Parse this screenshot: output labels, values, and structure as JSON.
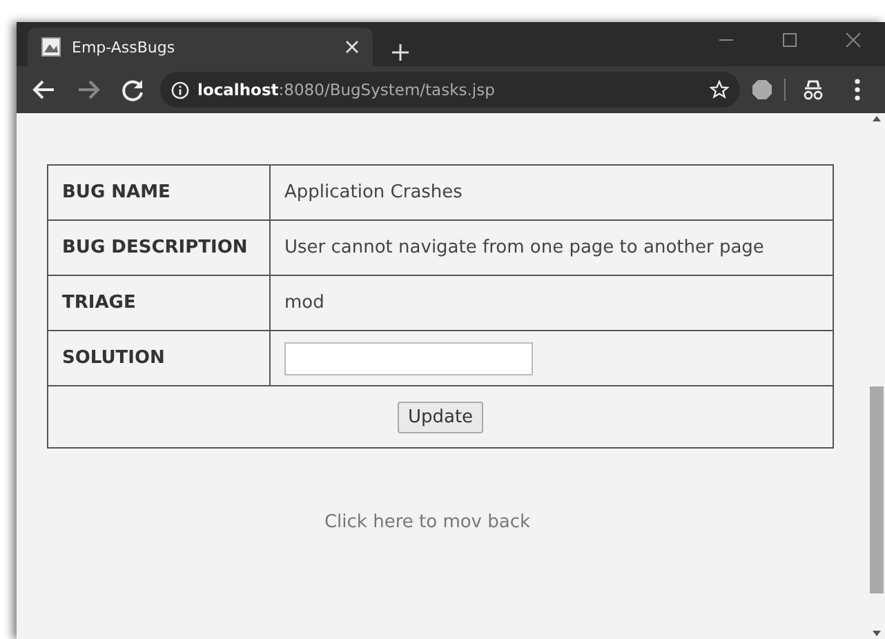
{
  "browser": {
    "tab_title": "Emp-AssBugs",
    "url_host": "localhost",
    "url_path": ":8080/BugSystem/tasks.jsp"
  },
  "table": {
    "rows": [
      {
        "label": "BUG NAME",
        "kind": "text",
        "value": "Application Crashes"
      },
      {
        "label": "BUG DESCRIPTION",
        "kind": "text",
        "value": "User cannot navigate from one page to another page"
      },
      {
        "label": "TRIAGE",
        "kind": "text",
        "value": "mod"
      },
      {
        "label": "SOLUTION",
        "kind": "input"
      }
    ],
    "button": "Update"
  },
  "back_link": "Click here to mov back"
}
